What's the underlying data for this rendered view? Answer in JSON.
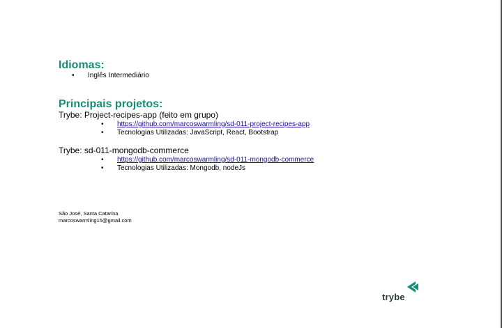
{
  "languages": {
    "heading": "Idiomas:",
    "items": [
      "Inglês Intermediário"
    ]
  },
  "projects": {
    "heading": "Principais projetos:",
    "list": [
      {
        "title": "Trybe: Project-recipes-app (feito em grupo)",
        "link": "https://github.com/marcoswarmling/sd-011-project-recipes-app",
        "tech": "Tecnologias Utilizadas: JavaScript, React, Bootstrap"
      },
      {
        "title": "Trybe: sd-011-mongodb-commerce",
        "link": "https://github.com/marcoswarmling/sd-011-mongodb-commerce",
        "tech": "Tecnologias Utilizadas: Mongodb, nodeJs"
      }
    ]
  },
  "footer": {
    "location": "São José, Santa Catarina",
    "email": "marcoswarmling15@gmail.com"
  },
  "logo": {
    "text": "trybe",
    "color": "#168e74"
  },
  "bullet": "•"
}
